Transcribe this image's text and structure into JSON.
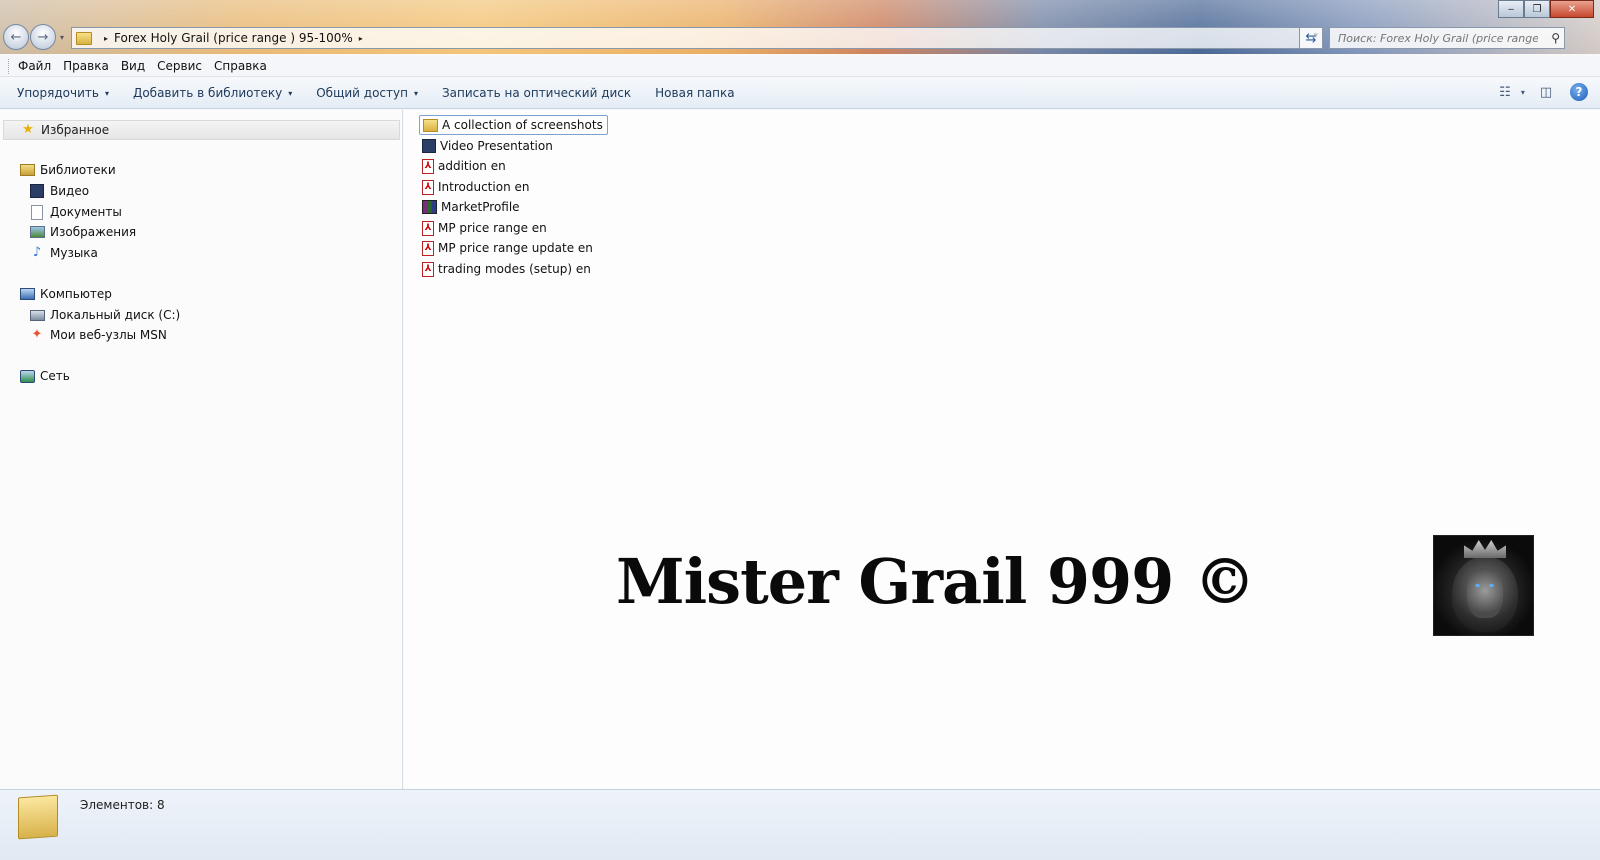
{
  "window": {
    "minimize_glyph": "‒",
    "maximize_glyph": "❐",
    "close_glyph": "✕"
  },
  "nav": {
    "back_glyph": "←",
    "forward_glyph": "→",
    "history_glyph": "▾"
  },
  "address": {
    "path": "Forex Holy Grail (price range ) 95-100%",
    "separator_glyph": "▸",
    "dropdown_glyph": "▾",
    "refresh_glyph": "⇆"
  },
  "search": {
    "placeholder": "Поиск: Forex Holy Grail (price range ) ...",
    "icon": "search-icon",
    "glyph": "⚲"
  },
  "menu": {
    "items": [
      "Файл",
      "Правка",
      "Вид",
      "Сервис",
      "Справка"
    ]
  },
  "commands": {
    "organize": "Упорядочить",
    "add_library": "Добавить в библиотеку",
    "share": "Общий доступ",
    "burn": "Записать на оптический диск",
    "new_folder": "Новая папка",
    "caret_glyph": "▾",
    "views_glyph": "☷",
    "views_caret": "▾",
    "preview_glyph": "◫",
    "help_glyph": "?"
  },
  "navpane": {
    "favorites": "Избранное",
    "star_glyph": "★",
    "libraries": "Библиотеки",
    "video": "Видео",
    "documents": "Документы",
    "images": "Изображения",
    "music": "Музыка",
    "music_glyph": "♪",
    "computer": "Компьютер",
    "local_disk": "Локальный диск (C:)",
    "msn": "Мои веб-узлы MSN",
    "msn_glyph": "✦",
    "network": "Сеть"
  },
  "files": [
    {
      "name": "A collection of screenshots",
      "type": "folder"
    },
    {
      "name": "Video Presentation",
      "type": "video"
    },
    {
      "name": "addition en",
      "type": "pdf"
    },
    {
      "name": "Introduction en",
      "type": "pdf"
    },
    {
      "name": "MarketProfile",
      "type": "rar"
    },
    {
      "name": "MP price range en",
      "type": "pdf"
    },
    {
      "name": "MP price range update en",
      "type": "pdf"
    },
    {
      "name": "trading modes (setup) en",
      "type": "pdf"
    }
  ],
  "pdf_glyph": "⅄",
  "watermark": {
    "text": "Mister Grail 999 ©"
  },
  "status": {
    "count": "Элементов: 8"
  },
  "colors": {
    "command_text": "#1e395b",
    "selection_border": "#7da2ce"
  }
}
